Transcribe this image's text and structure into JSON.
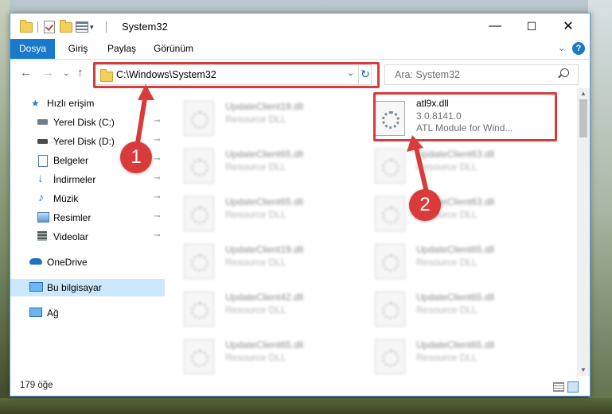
{
  "window": {
    "title": "System32",
    "controls": {
      "minimize": "—",
      "maximize": "☐",
      "close": "✕"
    }
  },
  "ribbon": {
    "tabs": [
      "Dosya",
      "Giriş",
      "Paylaş",
      "Görünüm"
    ],
    "help": "?"
  },
  "address": {
    "path": "C:\\Windows\\System32",
    "refresh": "↻",
    "dropdown": "⌄"
  },
  "search": {
    "placeholder": "Ara: System32"
  },
  "sidebar": {
    "items": [
      {
        "label": "Hızlı erişim",
        "icon": "star-icon",
        "pinned": false
      },
      {
        "label": "Yerel Disk (C:)",
        "icon": "drive-icon",
        "pinned": true
      },
      {
        "label": "Yerel Disk (D:)",
        "icon": "drive-icon",
        "pinned": true
      },
      {
        "label": "Belgeler",
        "icon": "documents-icon",
        "pinned": true
      },
      {
        "label": "İndirmeler",
        "icon": "download-icon",
        "pinned": true
      },
      {
        "label": "Müzik",
        "icon": "music-icon",
        "pinned": true
      },
      {
        "label": "Resimler",
        "icon": "pictures-icon",
        "pinned": true
      },
      {
        "label": "Videolar",
        "icon": "videos-icon",
        "pinned": true
      },
      {
        "label": "OneDrive",
        "icon": "cloud-icon",
        "pinned": false
      },
      {
        "label": "Bu bilgisayar",
        "icon": "computer-icon",
        "pinned": false,
        "selected": true
      },
      {
        "label": "Ağ",
        "icon": "network-icon",
        "pinned": false
      }
    ],
    "pin_glyph": "📌"
  },
  "files": {
    "left_column": [
      {
        "name": "UpdateClient19.dll",
        "type": "Resource DLL"
      },
      {
        "name": "UpdateClient65.dll",
        "type": "Resource DLL"
      },
      {
        "name": "UpdateClient65.dll",
        "type": "Resource DLL"
      },
      {
        "name": "UpdateClient19.dll",
        "type": "Resource DLL"
      },
      {
        "name": "UpdateClient42.dll",
        "type": "Resource DLL"
      },
      {
        "name": "UpdateClient65.dll",
        "type": "Resource DLL"
      }
    ],
    "right_column": [
      {
        "name": "atl9x.dll",
        "version": "3.0.8141.0",
        "type": "ATL Module for Wind...",
        "highlighted": true
      },
      {
        "name": "UpdateClient63.dll",
        "type": "Resource DLL"
      },
      {
        "name": "UpdateClient63.dll",
        "type": "Resource DLL"
      },
      {
        "name": "UpdateClient65.dll",
        "type": "Resource DLL"
      },
      {
        "name": "UpdateClient65.dll",
        "type": "Resource DLL"
      },
      {
        "name": "UpdateClient65.dll",
        "type": "Resource DLL"
      }
    ]
  },
  "status": {
    "item_count": "179 öğe"
  },
  "callouts": [
    "1",
    "2"
  ],
  "colors": {
    "accent": "#1979ca",
    "callout": "#d93a3a",
    "selection": "#cce8ff"
  }
}
